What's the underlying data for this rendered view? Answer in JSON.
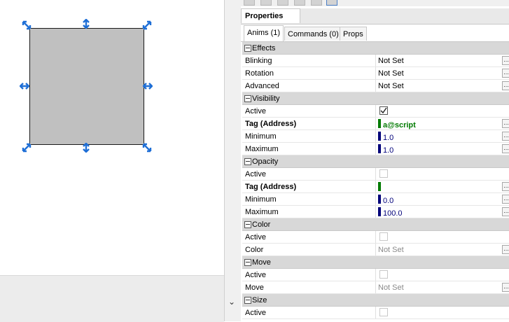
{
  "canvas": {
    "shape_color": "#c0c0c0",
    "handle_color": "#1f6fd6"
  },
  "panel": {
    "title": "Properties",
    "tabs": [
      {
        "label": "Anims (1)",
        "active": true
      },
      {
        "label": "Commands (0)",
        "active": false
      },
      {
        "label": "Props",
        "active": false
      }
    ],
    "ellipsis_label": "...",
    "sections": {
      "effects": {
        "title": "Effects",
        "rows": [
          {
            "name": "Blinking",
            "value": "Not Set"
          },
          {
            "name": "Rotation",
            "value": "Not Set"
          },
          {
            "name": "Advanced",
            "value": "Not Set"
          }
        ]
      },
      "visibility": {
        "title": "Visibility",
        "active": {
          "name": "Active",
          "checked": true
        },
        "tag": {
          "name": "Tag (Address)",
          "value": "a@script",
          "bar_color": "#007a00"
        },
        "minimum": {
          "name": "Minimum",
          "value": "1.0",
          "bar_color": "#00007a"
        },
        "maximum": {
          "name": "Maximum",
          "value": "1.0",
          "bar_color": "#00007a"
        }
      },
      "opacity": {
        "title": "Opacity",
        "active": {
          "name": "Active",
          "checked": false
        },
        "tag": {
          "name": "Tag (Address)",
          "value": "",
          "bar_color": "#007a00"
        },
        "minimum": {
          "name": "Minimum",
          "value": "0.0",
          "bar_color": "#00007a"
        },
        "maximum": {
          "name": "Maximum",
          "value": "100.0",
          "bar_color": "#00007a"
        }
      },
      "color": {
        "title": "Color",
        "active": {
          "name": "Active",
          "checked": false
        },
        "color": {
          "name": "Color",
          "value": "Not Set"
        }
      },
      "move": {
        "title": "Move",
        "active": {
          "name": "Active",
          "checked": false
        },
        "move": {
          "name": "Move",
          "value": "Not Set"
        }
      },
      "size": {
        "title": "Size",
        "active": {
          "name": "Active",
          "checked": false
        }
      }
    }
  }
}
